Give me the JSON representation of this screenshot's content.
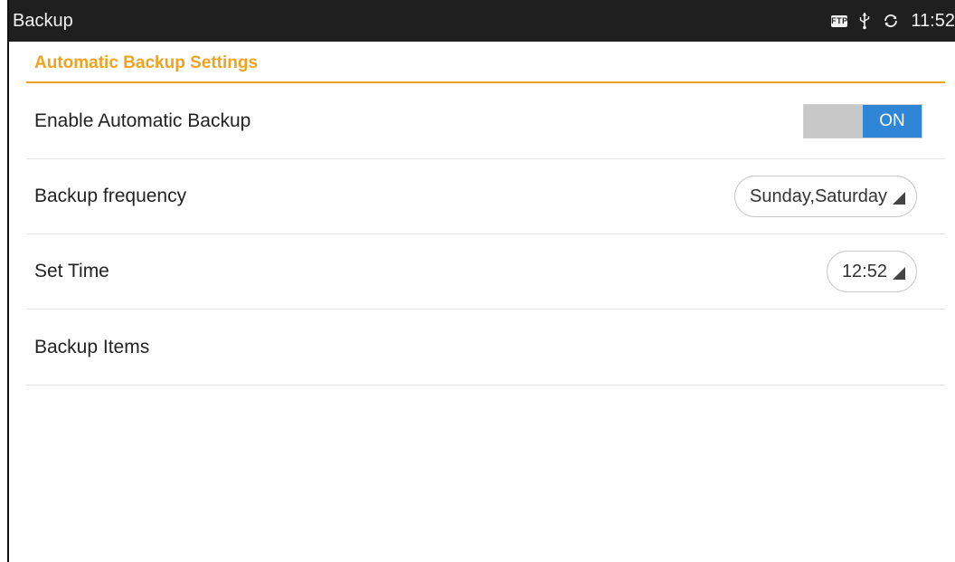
{
  "statusbar": {
    "title": "Backup",
    "ftp_label": "FTP",
    "time": "11:52"
  },
  "section": {
    "header": "Automatic Backup Settings"
  },
  "rows": {
    "enable": {
      "label": "Enable Automatic Backup",
      "toggle_label": "ON",
      "toggle_state": true
    },
    "frequency": {
      "label": "Backup frequency",
      "value": "Sunday,Saturday"
    },
    "time": {
      "label": "Set Time",
      "value": "12:52"
    },
    "items": {
      "label": "Backup Items"
    }
  },
  "colors": {
    "accent": "#f0a21f",
    "toggle_on": "#2f86d6",
    "statusbar_bg": "#1f1f1f"
  },
  "icons": [
    "ftp-icon",
    "usb-icon",
    "sync-icon",
    "dropdown-arrow-icon"
  ]
}
